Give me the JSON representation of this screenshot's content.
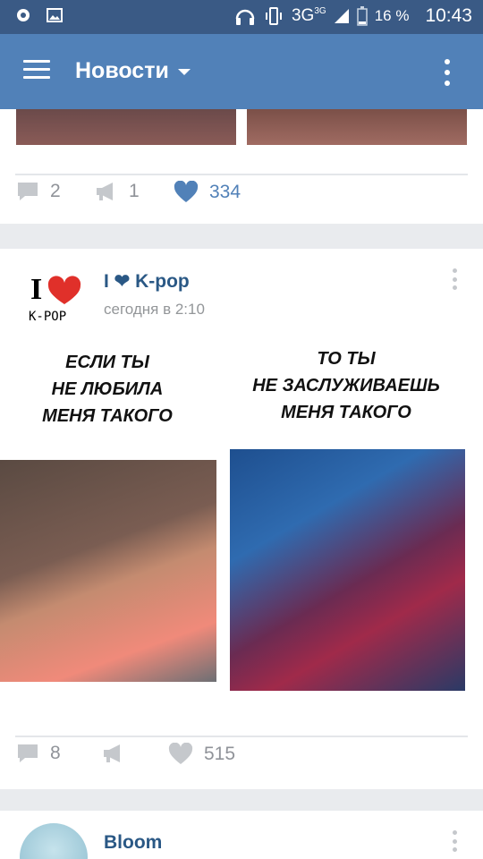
{
  "statusbar": {
    "network": "3G",
    "network_sup": "3G",
    "battery": "16 %",
    "time": "10:43"
  },
  "appbar": {
    "title": "Новости"
  },
  "post1": {
    "comments": "2",
    "reposts": "1",
    "likes": "334"
  },
  "post2": {
    "author": "I ❤ K-pop",
    "time": "сегодня в 2:10",
    "avatar_text": "K-POP",
    "caption_left": "ЕСЛИ ТЫ\nНЕ ЛЮБИЛА\nМЕНЯ ТАКОГО",
    "caption_right": "ТО ТЫ\nНЕ ЗАСЛУЖИВАЕШЬ\nМЕНЯ ТАКОГО",
    "comments": "8",
    "likes": "515"
  },
  "post3": {
    "author": "Bloom"
  },
  "colors": {
    "appbar": "#5181b8",
    "statusbar": "#3a5a85",
    "link": "#2a5885",
    "like_active": "#5181b8",
    "heart_red": "#e0302a"
  }
}
